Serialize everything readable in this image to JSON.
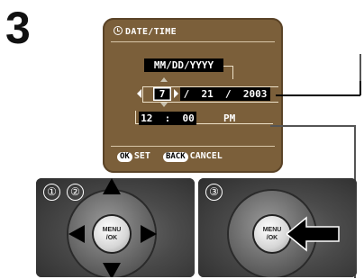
{
  "step": {
    "number": "3"
  },
  "lcd": {
    "title": "DATE/TIME",
    "date_format": "MM/DD/YYYY",
    "month": "7",
    "date_rest": "/  21  /  2003",
    "time": "12  :  00",
    "ampm": "PM",
    "ok_key": "OK",
    "ok_label": "SET",
    "back_key": "BACK",
    "back_label": "CANCEL"
  },
  "panels": {
    "left": {
      "step_labels": [
        "①",
        "②"
      ],
      "button_label_top": "MENU",
      "button_label_bottom": "/OK"
    },
    "right": {
      "step_labels": [
        "③"
      ],
      "button_label_top": "MENU",
      "button_label_bottom": "/OK"
    }
  },
  "colors": {
    "lcd_bg": "#7b5f3a",
    "arrow": "#000000",
    "highlight_box": "#000000"
  }
}
